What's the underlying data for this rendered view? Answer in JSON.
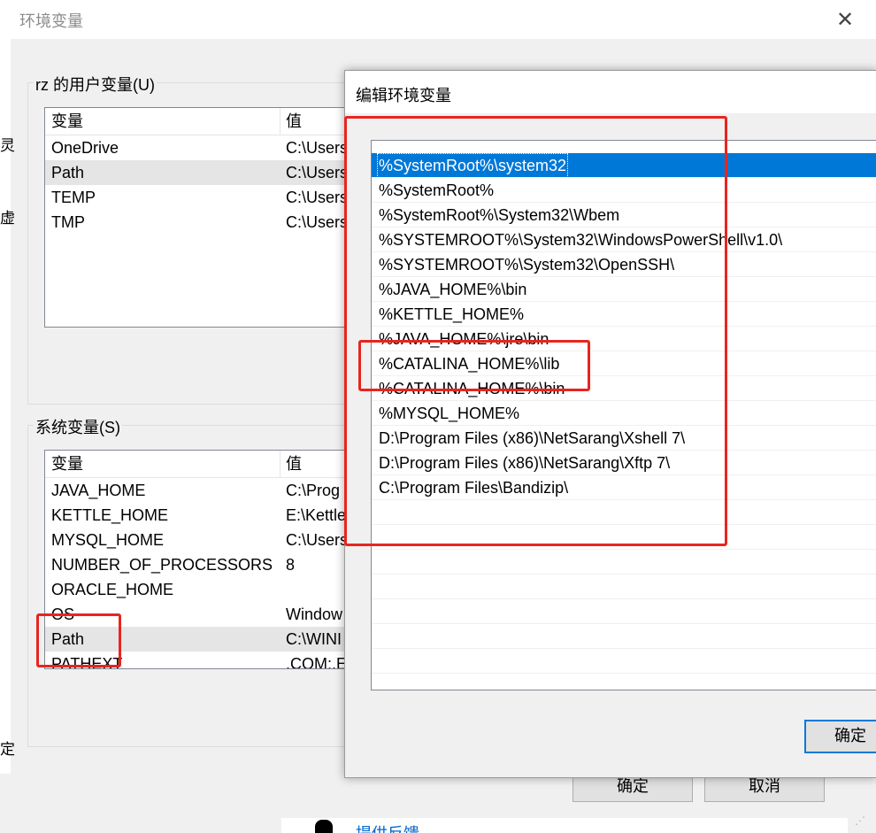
{
  "env_dialog": {
    "title": "环境变量",
    "close_glyph": "✕",
    "user_group_label": "rz 的用户变量(U)",
    "system_group_label": "系统变量(S)",
    "columns": {
      "variable": "变量",
      "value": "值"
    },
    "user_vars": [
      {
        "name": "OneDrive",
        "value": "C:\\Users"
      },
      {
        "name": "Path",
        "value": "C:\\Users"
      },
      {
        "name": "TEMP",
        "value": "C:\\Users"
      },
      {
        "name": "TMP",
        "value": "C:\\Users"
      }
    ],
    "system_vars": [
      {
        "name": "JAVA_HOME",
        "value": "C:\\Prog"
      },
      {
        "name": "KETTLE_HOME",
        "value": "E:\\Kettle"
      },
      {
        "name": "MYSQL_HOME",
        "value": "C:\\Users"
      },
      {
        "name": "NUMBER_OF_PROCESSORS",
        "value": "8"
      },
      {
        "name": "ORACLE_HOME",
        "value": ""
      },
      {
        "name": "OS",
        "value": "Window"
      },
      {
        "name": "Path",
        "value": "C:\\WINI"
      },
      {
        "name": "PATHEXT",
        "value": ".COM;.E"
      }
    ],
    "ok_label": "确定",
    "cancel_label": "取消",
    "left_fragments": [
      "灵",
      "虚",
      "定"
    ],
    "feedback_fragment": "提供反馈"
  },
  "edit_dialog": {
    "title": "编辑环境变量",
    "entries": [
      "%SystemRoot%\\system32",
      "%SystemRoot%",
      "%SystemRoot%\\System32\\Wbem",
      "%SYSTEMROOT%\\System32\\WindowsPowerShell\\v1.0\\",
      "%SYSTEMROOT%\\System32\\OpenSSH\\",
      "%JAVA_HOME%\\bin",
      "%KETTLE_HOME%",
      "%JAVA_HOME%\\jre\\bin",
      "%CATALINA_HOME%\\lib",
      "%CATALINA_HOME%\\bin",
      "%MYSQL_HOME%",
      "D:\\Program Files (x86)\\NetSarang\\Xshell 7\\",
      "D:\\Program Files (x86)\\NetSarang\\Xftp 7\\",
      "C:\\Program Files\\Bandizip\\"
    ],
    "selected_index": 0,
    "ok_label": "确定"
  },
  "colors": {
    "selection": "#0078d7",
    "annotation": "#e8251f"
  }
}
